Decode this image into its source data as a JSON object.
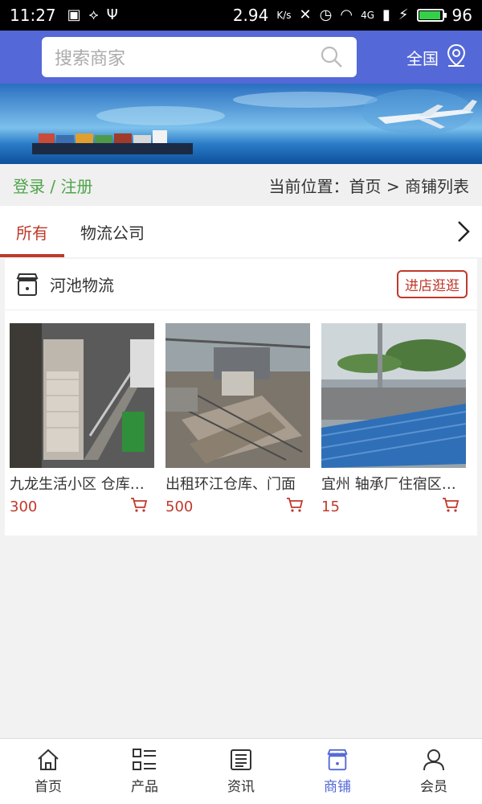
{
  "status_bar": {
    "time": "11:27",
    "net_speed": "2.94",
    "net_unit": "K/s",
    "signal": "4G",
    "battery": "96",
    "battery_level": 0.96
  },
  "header": {
    "search_placeholder": "搜索商家",
    "region_label": "全国"
  },
  "breadcrumb": {
    "login": "登录",
    "separator": " / ",
    "register": "注册",
    "location": "当前位置：首页 > 商铺列表"
  },
  "tabs": [
    {
      "label": "所有",
      "active": true
    },
    {
      "label": "物流公司",
      "active": false
    }
  ],
  "store": {
    "name": "河池物流",
    "visit_label": "进店逛逛",
    "products": [
      {
        "title": "九龙生活小区 仓库出租",
        "price": "300"
      },
      {
        "title": "出租环江仓库、门面",
        "price": "500"
      },
      {
        "title": "宜州 轴承厂住宿区仓库",
        "price": "15"
      }
    ]
  },
  "bottom_nav": [
    {
      "label": "首页",
      "icon": "home-icon",
      "active": false
    },
    {
      "label": "产品",
      "icon": "grid-list-icon",
      "active": false
    },
    {
      "label": "资讯",
      "icon": "news-icon",
      "active": false
    },
    {
      "label": "商铺",
      "icon": "shop-icon",
      "active": true
    },
    {
      "label": "会员",
      "icon": "user-icon",
      "active": false
    }
  ],
  "colors": {
    "primary": "#5468d8",
    "accent_red": "#c0392b",
    "login_green": "#4ea44a"
  }
}
